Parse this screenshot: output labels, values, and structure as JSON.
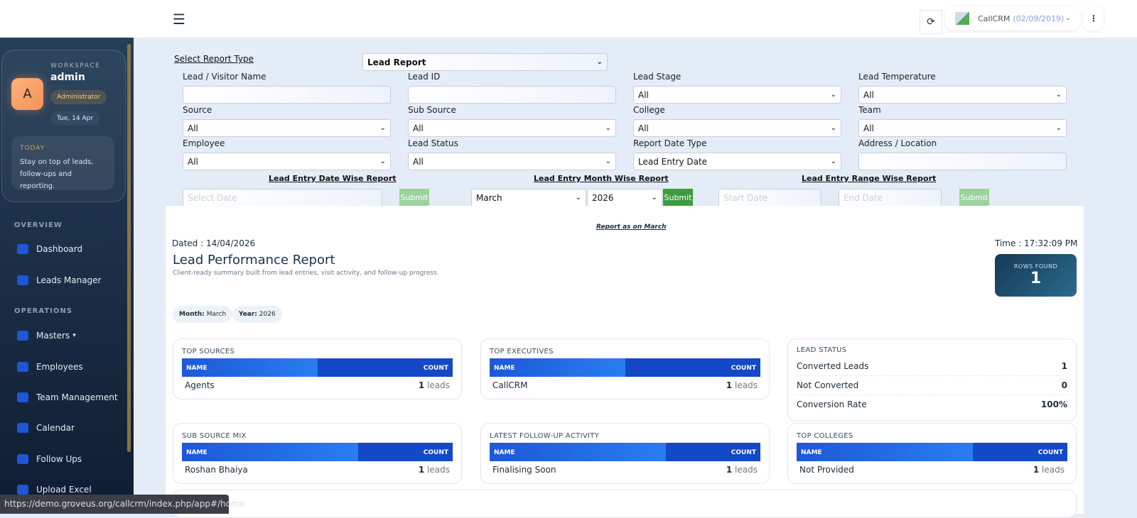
{
  "header": {
    "menu_icon": "hamburger-icon",
    "refresh_icon": "refresh-icon",
    "user_name": "CallCRM",
    "user_date": "(02/09/2019)",
    "more_icon": "kebab-icon"
  },
  "sidebar": {
    "workspace_label": "WORKSPACE",
    "user": "admin",
    "avatar_letter": "A",
    "role": "Administrator",
    "date": "Tue, 14 Apr",
    "today_title": "TODAY",
    "today_text": "Stay on top of leads, follow-ups and reporting.",
    "sections": [
      {
        "title": "OVERVIEW"
      },
      {
        "title": "OPERATIONS"
      }
    ],
    "items": [
      {
        "label": "Dashboard",
        "icon": "dashboard-icon"
      },
      {
        "label": "Leads Manager",
        "icon": "users-icon"
      },
      {
        "label": "Masters",
        "icon": "building-icon"
      },
      {
        "label": "Employees",
        "icon": "user-icon"
      },
      {
        "label": "Team Management",
        "icon": "users-icon"
      },
      {
        "label": "Calendar",
        "icon": "calendar-icon"
      },
      {
        "label": "Follow Ups",
        "icon": "fax-icon"
      },
      {
        "label": "Upload Excel",
        "icon": "excel-icon"
      }
    ]
  },
  "status_url": "https://demo.groveus.org/callcrm/index.php/app#/home",
  "filters": {
    "report_type_label": "Select Report Type",
    "report_type": "Lead Report",
    "fields": [
      {
        "label": "Lead / Visitor Name",
        "value": ""
      },
      {
        "label": "Lead ID",
        "value": ""
      },
      {
        "label": "Lead Stage",
        "value": "All"
      },
      {
        "label": "Lead Temperature",
        "value": "All"
      },
      {
        "label": "Source",
        "value": "All"
      },
      {
        "label": "Sub Source",
        "value": "All"
      },
      {
        "label": "College",
        "value": "All"
      },
      {
        "label": "Team",
        "value": "All"
      },
      {
        "label": "Employee",
        "value": "All"
      },
      {
        "label": "Lead Status",
        "value": "All"
      },
      {
        "label": "Report Date Type",
        "value": "Lead Entry Date"
      },
      {
        "label": "Address / Location",
        "value": ""
      }
    ],
    "date_wise": {
      "title": "Lead Entry Date Wise Report",
      "placeholder": "Select Date",
      "submit": "Submit"
    },
    "month_wise": {
      "title": "Lead Entry Month Wise Report",
      "month": "March",
      "year": "2026",
      "submit": "Submit"
    },
    "range_wise": {
      "title": "Lead Entry Range Wise Report",
      "start_placeholder": "Start Date",
      "end_placeholder": "End Date",
      "submit": "Submit"
    }
  },
  "report": {
    "as_on": "Report as on March",
    "dated": "Dated : 14/04/2026",
    "time": "Time : 17:32:09 PM",
    "title": "Lead Performance Report",
    "subtitle": "Client-ready summary built from lead entries, visit activity, and follow-up progress.",
    "rows_found_label": "ROWS FOUND",
    "rows_found": "1",
    "month_label": "Month:",
    "month": "March",
    "year_label": "Year:",
    "year": "2026",
    "col_name": "NAME",
    "col_count": "COUNT",
    "leads_suffix": "leads",
    "cards": [
      {
        "title": "TOP SOURCES",
        "name": "Agents",
        "count": "1"
      },
      {
        "title": "TOP EXECUTIVES",
        "name": "CallCRM",
        "count": "1"
      },
      {
        "title": "SUB SOURCE MIX",
        "name": "Roshan Bhaiya",
        "count": "1"
      },
      {
        "title": "LATEST FOLLOW-UP ACTIVITY",
        "name": "Finalising Soon",
        "count": "1"
      },
      {
        "title": "TOP COLLEGES",
        "name": "Not Provided",
        "count": "1"
      }
    ],
    "lead_status": {
      "title": "LEAD STATUS",
      "rows": [
        {
          "label": "Converted Leads",
          "value": "1"
        },
        {
          "label": "Not Converted",
          "value": "0"
        },
        {
          "label": "Conversion Rate",
          "value": "100%"
        }
      ]
    }
  }
}
